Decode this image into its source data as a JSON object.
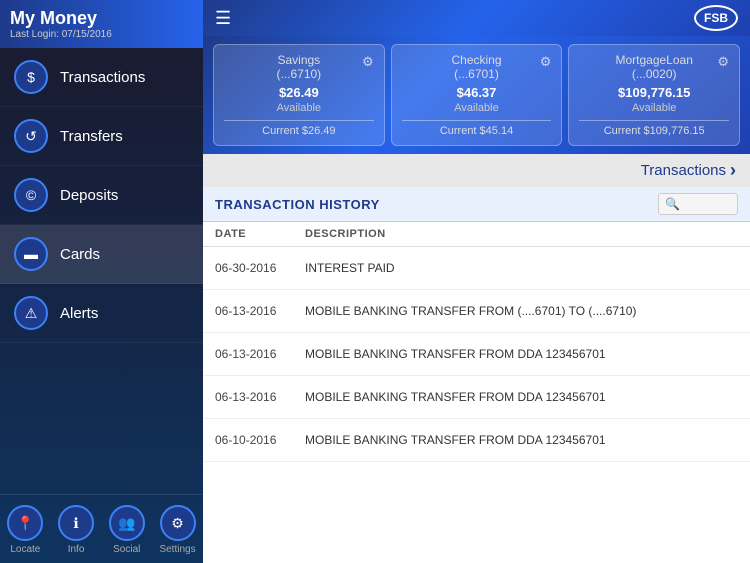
{
  "sidebar": {
    "title": "My Money",
    "last_login_label": "Last Login: 07/15/2016",
    "nav_items": [
      {
        "id": "transactions",
        "label": "Transactions",
        "icon": "$"
      },
      {
        "id": "transfers",
        "label": "Transfers",
        "icon": "↺"
      },
      {
        "id": "deposits",
        "label": "Deposits",
        "icon": "©"
      },
      {
        "id": "cards",
        "label": "Cards",
        "icon": "▬"
      },
      {
        "id": "alerts",
        "label": "Alerts",
        "icon": "⚠"
      }
    ],
    "bottom_nav": [
      {
        "id": "locate",
        "label": "Locate",
        "icon": "📍"
      },
      {
        "id": "info",
        "label": "Info",
        "icon": "ℹ"
      },
      {
        "id": "social",
        "label": "Social",
        "icon": "👥"
      },
      {
        "id": "settings",
        "label": "Settings",
        "icon": "⚙"
      }
    ]
  },
  "topbar": {
    "logo_text": "FSB"
  },
  "accounts": [
    {
      "type": "Savings",
      "number": "(...6710)",
      "amount": "$26.49",
      "available_label": "Available",
      "current_label": "Current $26.49"
    },
    {
      "type": "Checking",
      "number": "(...6701)",
      "amount": "$46.37",
      "available_label": "Available",
      "current_label": "Current $45.14"
    },
    {
      "type": "MortgageLoan",
      "number": "(...0020)",
      "amount": "$109,776.15",
      "available_label": "Available",
      "current_label": "Current $109,776.15"
    }
  ],
  "transactions_nav": {
    "label": "Transactions"
  },
  "transaction_history": {
    "section_label": "TRANSACTION HISTORY",
    "search_placeholder": "Q",
    "col_date": "DATE",
    "col_description": "DESCRIPTION",
    "rows": [
      {
        "date": "06-30-2016",
        "description": "INTEREST PAID"
      },
      {
        "date": "06-13-2016",
        "description": "MOBILE BANKING TRANSFER FROM (....6701) TO (....6710)"
      },
      {
        "date": "06-13-2016",
        "description": "MOBILE BANKING TRANSFER FROM DDA 123456701"
      },
      {
        "date": "06-13-2016",
        "description": "MOBILE BANKING TRANSFER FROM DDA 123456701"
      },
      {
        "date": "06-10-2016",
        "description": "MOBILE BANKING TRANSFER FROM DDA 123456701"
      }
    ]
  }
}
